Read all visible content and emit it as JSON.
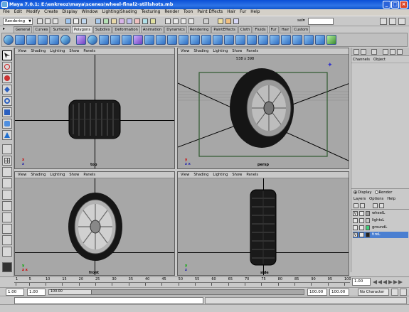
{
  "window": {
    "title": "Maya 7.0.1: E:\\enkreoz\\maya\\scenes\\wheel-final2-stillshots.mb"
  },
  "menubar": [
    "File",
    "Edit",
    "Modify",
    "Create",
    "Display",
    "Window",
    "Lighting/Shading",
    "Texturing",
    "Render",
    "Toon",
    "Paint Effects",
    "Hair",
    "Fur",
    "Help"
  ],
  "statusline": {
    "mode": "Rendering",
    "sel_label": "sel▾"
  },
  "shelf_tabs": [
    "General",
    "Curves",
    "Surfaces",
    "Polygons",
    "Subdivs",
    "Deformation",
    "Animation",
    "Dynamics",
    "Rendering",
    "PaintEffects",
    "Cloth",
    "Fluids",
    "Fur",
    "Hair",
    "Custom"
  ],
  "active_shelf_tab": "Polygons",
  "pane_menu": [
    "View",
    "Shading",
    "Lighting",
    "Show",
    "Panels"
  ],
  "panes": {
    "top": {
      "camera": "top"
    },
    "persp": {
      "camera": "persp",
      "resolution": "538 x 398"
    },
    "front": {
      "camera": "front"
    },
    "side": {
      "camera": "side"
    }
  },
  "channelbox": {
    "tabs": [
      "Channels",
      "Object"
    ],
    "layer_mode": {
      "display": "Display",
      "render": "Render"
    },
    "layer_menu": [
      "Layers",
      "Options",
      "Help"
    ],
    "layers": [
      {
        "name": "wheelL",
        "visible": "V",
        "color": "#a0a0a0"
      },
      {
        "name": "lightsL",
        "visible": "",
        "color": "#c8c8c8"
      },
      {
        "name": "groundL",
        "visible": "",
        "color": "#3fd07a"
      },
      {
        "name": "tireL",
        "visible": "V",
        "color": "#222222",
        "selected": true
      }
    ]
  },
  "timeslider": {
    "ticks": [
      "1",
      "5",
      "10",
      "15",
      "20",
      "25",
      "30",
      "35",
      "40",
      "45",
      "50",
      "55",
      "60",
      "65",
      "70",
      "75",
      "80",
      "85",
      "90",
      "95",
      "100"
    ],
    "current_frame": "1.00"
  },
  "rangeslider": {
    "start": "1.00",
    "anim_start": "1.00",
    "range_text": "100.00",
    "end": "100.00",
    "anim_end": "100.00",
    "character_set": "No Character Set"
  },
  "colors": {
    "titlebar": "#0a4fd6",
    "viewport": "#a7a7a7",
    "selection": "#4a7fd1"
  }
}
